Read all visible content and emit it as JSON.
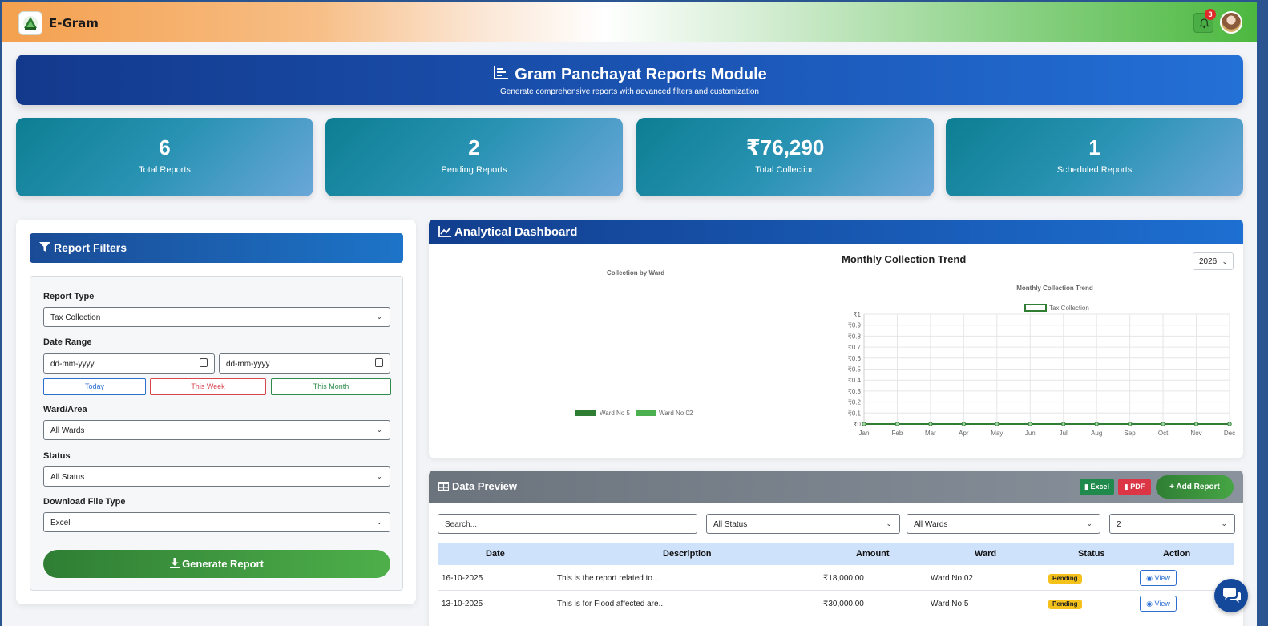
{
  "app": {
    "title": "E-Gram",
    "notification_count": "3"
  },
  "hero": {
    "title": "Gram Panchayat Reports Module",
    "subtitle": "Generate comprehensive reports with advanced filters and customization"
  },
  "stats": [
    {
      "value": "6",
      "label": "Total Reports"
    },
    {
      "value": "2",
      "label": "Pending Reports"
    },
    {
      "value": "₹76,290",
      "label": "Total Collection"
    },
    {
      "value": "1",
      "label": "Scheduled Reports"
    }
  ],
  "filters": {
    "title": "Report Filters",
    "report_type_label": "Report Type",
    "report_type_value": "Tax Collection",
    "date_range_label": "Date Range",
    "date_from_placeholder": "dd-mm-yyyy",
    "date_to_placeholder": "dd-mm-yyyy",
    "quick_today": "Today",
    "quick_week": "This Week",
    "quick_month": "This Month",
    "ward_label": "Ward/Area",
    "ward_value": "All Wards",
    "status_label": "Status",
    "status_value": "All Status",
    "file_type_label": "Download File Type",
    "file_type_value": "Excel",
    "generate_label": "Generate Report"
  },
  "analytics": {
    "title": "Analytical Dashboard",
    "ward_chart_title": "Collection by Ward",
    "ward_legend": [
      {
        "label": "Ward No 5",
        "color": "#2e7d32"
      },
      {
        "label": "Ward No 02",
        "color": "#4caf50"
      }
    ],
    "trend_heading": "Monthly Collection Trend",
    "year_value": "2026"
  },
  "chart_data": {
    "type": "line",
    "title": "Monthly Collection Trend",
    "series": [
      {
        "name": "Tax Collection",
        "values": [
          0,
          0,
          0,
          0,
          0,
          0,
          0,
          0,
          0,
          0,
          0,
          0
        ],
        "color": "#2e7d32"
      }
    ],
    "categories": [
      "Jan",
      "Feb",
      "Mar",
      "Apr",
      "May",
      "Jun",
      "Jul",
      "Aug",
      "Sep",
      "Oct",
      "Nov",
      "Dec"
    ],
    "y_ticks": [
      "₹0",
      "₹0.1",
      "₹0.2",
      "₹0.3",
      "₹0.4",
      "₹0.5",
      "₹0.6",
      "₹0.7",
      "₹0.8",
      "₹0.9",
      "₹1"
    ],
    "ylim": [
      0,
      1
    ],
    "grid": true,
    "legend_position": "top"
  },
  "preview": {
    "title": "Data Preview",
    "excel_label": "Excel",
    "pdf_label": "PDF",
    "add_label": "+ Add Report",
    "search_placeholder": "Search...",
    "status_filter": "All Status",
    "ward_filter": "All Wards",
    "page_size": "2",
    "columns": [
      "Date",
      "Description",
      "Amount",
      "Ward",
      "Status",
      "Action"
    ],
    "rows": [
      {
        "date": "16-10-2025",
        "description": "This is the report related to...",
        "amount": "₹18,000.00",
        "ward": "Ward No 02",
        "status": "Pending",
        "action": "View"
      },
      {
        "date": "13-10-2025",
        "description": "This is for Flood affected are...",
        "amount": "₹30,000.00",
        "ward": "Ward No 5",
        "status": "Pending",
        "action": "View"
      }
    ]
  },
  "colors": {
    "primary_blue": "#1b55b5",
    "accent_green": "#4caf50",
    "pending_yellow": "#f5c11b",
    "danger_red": "#dc3545"
  }
}
